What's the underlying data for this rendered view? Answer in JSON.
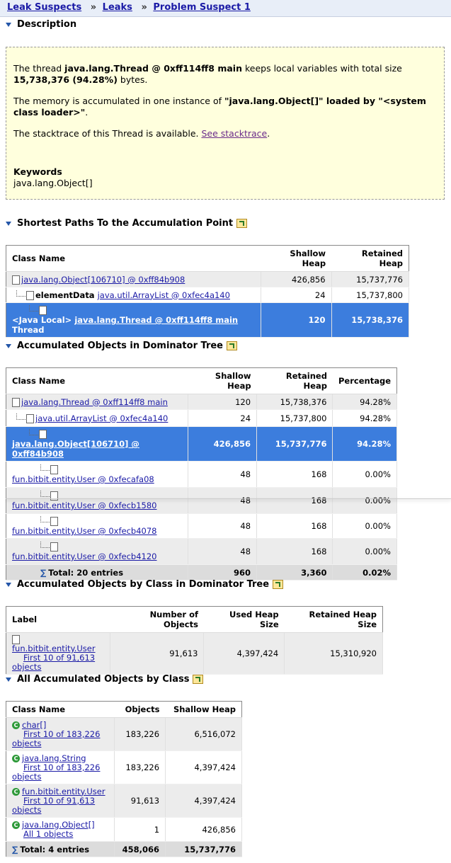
{
  "breadcrumb": {
    "leak_suspects": "Leak Suspects",
    "leaks": "Leaks",
    "problem": "Problem Suspect 1",
    "sep": "»"
  },
  "description": {
    "heading": "Description",
    "p1_pre": "The thread ",
    "p1_bold": "java.lang.Thread @ 0xff114ff8 main",
    "p1_mid": " keeps local variables with total size ",
    "p1_size": "15,738,376 (94.28%)",
    "p1_post": " bytes.",
    "p2_pre": "The memory is accumulated in one instance of ",
    "p2_bold": "\"java.lang.Object[]\"",
    "p2_mid": " loaded by \"",
    "p2_loader": "<system class loader>\"",
    "p2_post": ".",
    "p3_pre": "The stacktrace of this Thread is available. ",
    "p3_link": "See stacktrace",
    "p3_post": ".",
    "keywords_label": "Keywords",
    "keywords": "java.lang.Object[]"
  },
  "shortest_paths": {
    "heading": "Shortest Paths To the Accumulation Point",
    "headers": [
      "Class Name",
      "Shallow Heap",
      "Retained Heap"
    ],
    "rows": [
      {
        "link": "java.lang.Object[106710] @ 0xff84b908",
        "shallow": "426,856",
        "retained": "15,737,776"
      },
      {
        "prefix": "elementData ",
        "link": "java.util.ArrayList @ 0xfec4a140",
        "shallow": "24",
        "retained": "15,737,800"
      },
      {
        "prefix": "<Java Local> ",
        "link": "java.lang.Thread @ 0xff114ff8 main",
        "suffix": " Thread",
        "shallow": "120",
        "retained": "15,738,376"
      }
    ]
  },
  "dominator": {
    "heading": "Accumulated Objects in Dominator Tree",
    "headers": [
      "Class Name",
      "Shallow Heap",
      "Retained Heap",
      "Percentage"
    ],
    "rows": [
      {
        "link": "java.lang.Thread @ 0xff114ff8 main",
        "shallow": "120",
        "retained": "15,738,376",
        "pct": "94.28%"
      },
      {
        "link": "java.util.ArrayList @ 0xfec4a140",
        "shallow": "24",
        "retained": "15,737,800",
        "pct": "94.28%"
      },
      {
        "link": "java.lang.Object[106710] @ 0xff84b908",
        "shallow": "426,856",
        "retained": "15,737,776",
        "pct": "94.28%"
      },
      {
        "link": "fun.bitbit.entity.User @ 0xfecafa08",
        "shallow": "48",
        "retained": "168",
        "pct": "0.00%"
      },
      {
        "link": "fun.bitbit.entity.User @ 0xfecb1580",
        "shallow": "48",
        "retained": "168",
        "pct": "0.00%"
      },
      {
        "link": "fun.bitbit.entity.User @ 0xfecb4078",
        "shallow": "48",
        "retained": "168",
        "pct": "0.00%"
      },
      {
        "link": "fun.bitbit.entity.User @ 0xfecb4120",
        "shallow": "48",
        "retained": "168",
        "pct": "0.00%"
      }
    ],
    "total": {
      "label": "Total: 20 entries",
      "shallow": "960",
      "retained": "3,360",
      "pct": "0.02%"
    }
  },
  "by_class_dom": {
    "heading": "Accumulated Objects by Class in Dominator Tree",
    "headers": [
      "Label",
      "Number of Objects",
      "Used Heap Size",
      "Retained Heap Size"
    ],
    "rows": [
      {
        "link": "fun.bitbit.entity.User",
        "sub": "First 10 of 91,613",
        "sub2": "objects",
        "num": "91,613",
        "used": "4,397,424",
        "retained": "15,310,920"
      }
    ]
  },
  "all_by_class": {
    "heading": "All Accumulated Objects by Class",
    "headers": [
      "Class Name",
      "Objects",
      "Shallow Heap"
    ],
    "rows": [
      {
        "link": "char[]",
        "sub": "First 10 of 183,226",
        "sub2": "objects",
        "objects": "183,226",
        "shallow": "6,516,072"
      },
      {
        "link": "java.lang.String",
        "sub": "First 10 of 183,226",
        "sub2": "objects",
        "objects": "183,226",
        "shallow": "4,397,424"
      },
      {
        "link": "fun.bitbit.entity.User",
        "sub": "First 10 of 91,613",
        "sub2": "objects",
        "objects": "91,613",
        "shallow": "4,397,424"
      },
      {
        "link": "java.lang.Object[]",
        "sub": "All 1 objects",
        "sub2": "",
        "objects": "1",
        "shallow": "426,856"
      }
    ],
    "total": {
      "label": "Total: 4 entries",
      "objects": "458,066",
      "shallow": "15,737,776"
    }
  },
  "icons": {
    "expand": "export-icon",
    "class": "class-icon",
    "object": "object-icon",
    "sum": "sum-icon"
  }
}
